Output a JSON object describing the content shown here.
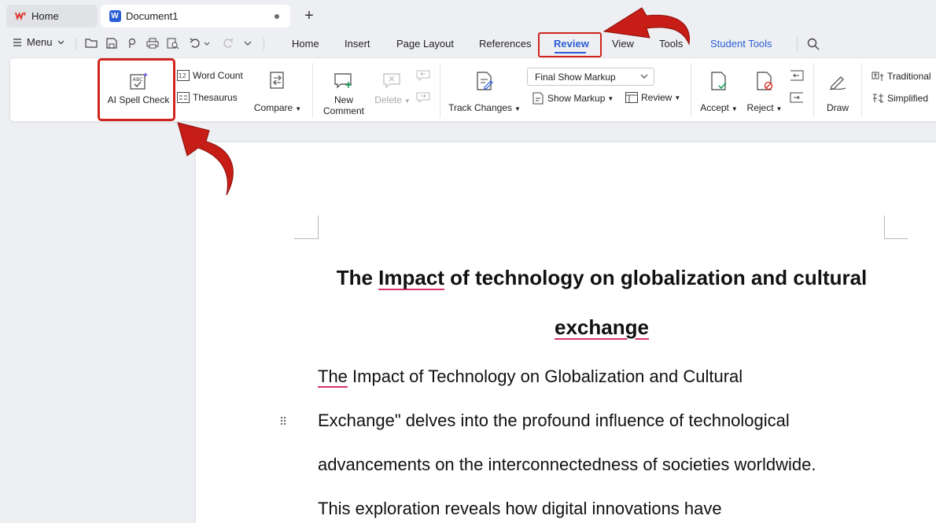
{
  "tabs": {
    "home_label": "Home",
    "doc_label": "Document1",
    "new_tab_symbol": "+",
    "doc_badge": "W"
  },
  "menu": {
    "menu_label": "Menu",
    "ribbon_tabs": [
      "Home",
      "Insert",
      "Page Layout",
      "References",
      "Review",
      "View",
      "Tools",
      "Student Tools"
    ],
    "active_tab": "Review"
  },
  "ribbon": {
    "ai_spell_check": "AI Spell Check",
    "word_count": "Word Count",
    "thesaurus": "Thesaurus",
    "compare": "Compare",
    "new_comment_line1": "New",
    "new_comment_line2": "Comment",
    "delete": "Delete",
    "track_changes": "Track Changes",
    "markup_select_value": "Final Show Markup",
    "show_markup": "Show Markup",
    "review": "Review",
    "accept": "Accept",
    "reject": "Reject",
    "draw": "Draw",
    "traditional": "Traditional",
    "simplified": "Simplified"
  },
  "document": {
    "title_part1": "The ",
    "title_misspelled": "Impact",
    "title_part2": " of technology on globalization and cultural",
    "title_line2": "exchange",
    "body_first_word": "The",
    "body_line1_rest": " Impact of Technology on Globalization and Cultural",
    "body_line2": "Exchange\" delves into the profound influence of technological",
    "body_line3": "advancements on the interconnectedness of societies worldwide.",
    "body_line4": "This exploration reveals how digital innovations have"
  },
  "colors": {
    "accent": "#2b5ed8",
    "highlight_red": "#d0241e",
    "spell_underline": "#d8336a"
  }
}
